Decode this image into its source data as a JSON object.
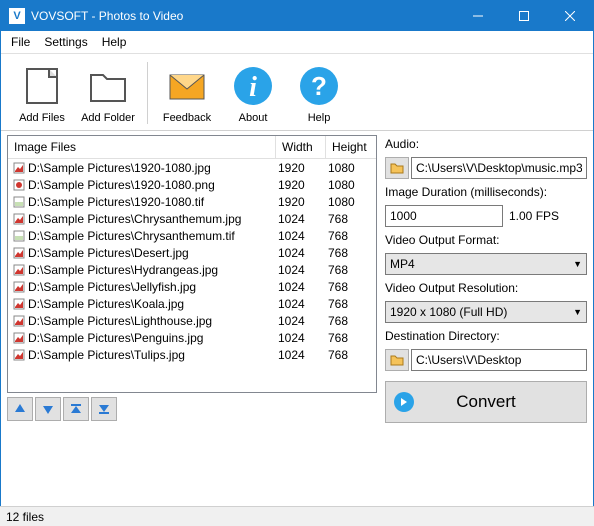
{
  "window": {
    "title": "VOVSOFT - Photos to Video"
  },
  "menu": {
    "file": "File",
    "settings": "Settings",
    "help": "Help"
  },
  "toolbar": {
    "add_files": "Add Files",
    "add_folder": "Add Folder",
    "feedback": "Feedback",
    "about": "About",
    "help": "Help"
  },
  "list": {
    "h_image": "Image Files",
    "h_width": "Width",
    "h_height": "Height",
    "rows": [
      {
        "icon": "jpg",
        "path": "D:\\Sample Pictures\\1920-1080.jpg",
        "w": "1920",
        "h": "1080"
      },
      {
        "icon": "png",
        "path": "D:\\Sample Pictures\\1920-1080.png",
        "w": "1920",
        "h": "1080"
      },
      {
        "icon": "tif",
        "path": "D:\\Sample Pictures\\1920-1080.tif",
        "w": "1920",
        "h": "1080"
      },
      {
        "icon": "jpg",
        "path": "D:\\Sample Pictures\\Chrysanthemum.jpg",
        "w": "1024",
        "h": "768"
      },
      {
        "icon": "tif",
        "path": "D:\\Sample Pictures\\Chrysanthemum.tif",
        "w": "1024",
        "h": "768"
      },
      {
        "icon": "jpg",
        "path": "D:\\Sample Pictures\\Desert.jpg",
        "w": "1024",
        "h": "768"
      },
      {
        "icon": "jpg",
        "path": "D:\\Sample Pictures\\Hydrangeas.jpg",
        "w": "1024",
        "h": "768"
      },
      {
        "icon": "jpg",
        "path": "D:\\Sample Pictures\\Jellyfish.jpg",
        "w": "1024",
        "h": "768"
      },
      {
        "icon": "jpg",
        "path": "D:\\Sample Pictures\\Koala.jpg",
        "w": "1024",
        "h": "768"
      },
      {
        "icon": "jpg",
        "path": "D:\\Sample Pictures\\Lighthouse.jpg",
        "w": "1024",
        "h": "768"
      },
      {
        "icon": "jpg",
        "path": "D:\\Sample Pictures\\Penguins.jpg",
        "w": "1024",
        "h": "768"
      },
      {
        "icon": "jpg",
        "path": "D:\\Sample Pictures\\Tulips.jpg",
        "w": "1024",
        "h": "768"
      }
    ]
  },
  "side": {
    "audio_label": "Audio:",
    "audio_path": "C:\\Users\\V\\Desktop\\music.mp3",
    "duration_label": "Image Duration (milliseconds):",
    "duration_value": "1000",
    "fps": "1.00 FPS",
    "format_label": "Video Output Format:",
    "format_value": "MP4",
    "resolution_label": "Video Output Resolution:",
    "resolution_value": "1920 x 1080 (Full HD)",
    "dest_label": "Destination Directory:",
    "dest_path": "C:\\Users\\V\\Desktop",
    "convert": "Convert"
  },
  "status": {
    "text": "12 files"
  }
}
